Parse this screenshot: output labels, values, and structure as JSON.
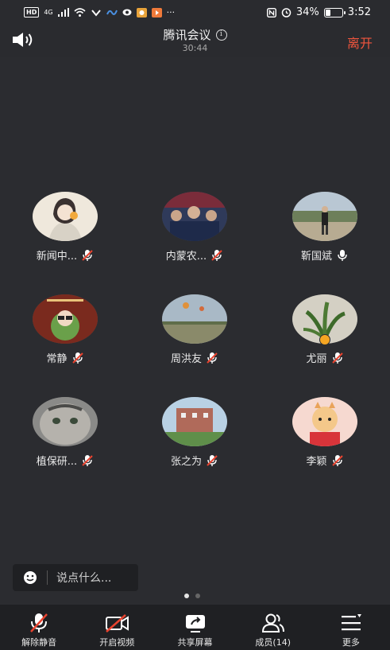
{
  "status_bar": {
    "hd": "HD",
    "network": "4G",
    "battery_text": "34%",
    "battery_level": 0.34,
    "time": "3:52"
  },
  "header": {
    "title": "腾讯会议",
    "timer": "30:44",
    "leave_label": "离开"
  },
  "participants": [
    {
      "name": "新闻中...",
      "muted": true
    },
    {
      "name": "内蒙农...",
      "muted": true
    },
    {
      "name": "靳国斌",
      "muted": false
    },
    {
      "name": "常静",
      "muted": true
    },
    {
      "name": "周洪友",
      "muted": true
    },
    {
      "name": "尤丽",
      "muted": true
    },
    {
      "name": "植保研...",
      "muted": true
    },
    {
      "name": "张之为",
      "muted": true
    },
    {
      "name": "李颖",
      "muted": true
    }
  ],
  "chat": {
    "placeholder": "说点什么..."
  },
  "pagination": {
    "pages": 2,
    "current": 1
  },
  "toolbar": {
    "unmute_label": "解除静音",
    "video_label": "开启视频",
    "share_label": "共享屏幕",
    "members_label": "成员(14)",
    "more_label": "更多"
  },
  "colors": {
    "background": "#2b2c30",
    "toolbar": "#1f2023",
    "leave": "#f0553d",
    "muted_slash": "#e8432f"
  }
}
